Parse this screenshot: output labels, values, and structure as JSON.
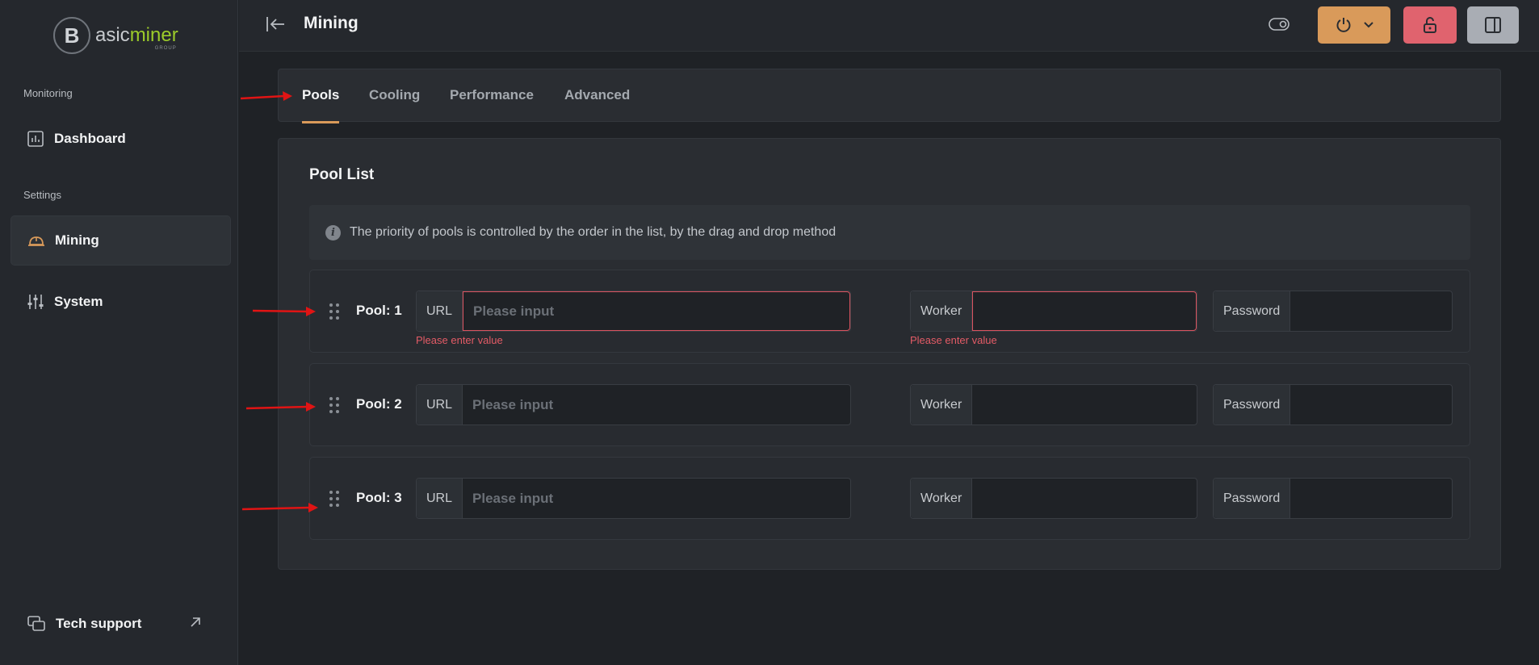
{
  "sidebar": {
    "logo": {
      "text_main": "asic",
      "text_accent": "miner",
      "subtitle": "GROUP",
      "mark": "B"
    },
    "sections": [
      {
        "label": "Monitoring"
      },
      {
        "label": "Settings"
      }
    ],
    "items": [
      {
        "label": "Dashboard",
        "icon": "chart-icon"
      },
      {
        "label": "Mining",
        "icon": "hardhat-icon",
        "active": true
      },
      {
        "label": "System",
        "icon": "sliders-icon"
      },
      {
        "label": "Tech support",
        "icon": "chat-icon"
      }
    ]
  },
  "header": {
    "title": "Mining"
  },
  "tabs": [
    {
      "label": "Pools",
      "active": true
    },
    {
      "label": "Cooling"
    },
    {
      "label": "Performance"
    },
    {
      "label": "Advanced"
    }
  ],
  "pool_list": {
    "title": "Pool List",
    "info": "The priority of pools is controlled by the order in the list, by the drag and drop method",
    "url_label": "URL",
    "worker_label": "Worker",
    "password_label": "Password",
    "url_placeholder": "Please input",
    "error_text": "Please enter value",
    "pools": [
      {
        "label": "Pool: 1",
        "url": "",
        "worker": "",
        "password": "",
        "error": true
      },
      {
        "label": "Pool: 2",
        "url": "",
        "worker": "",
        "password": "",
        "error": false
      },
      {
        "label": "Pool: 3",
        "url": "",
        "worker": "",
        "password": "",
        "error": false
      }
    ]
  },
  "colors": {
    "accent": "#d99a5a",
    "danger": "#e0636e",
    "annotation_arrow": "#e01414"
  }
}
